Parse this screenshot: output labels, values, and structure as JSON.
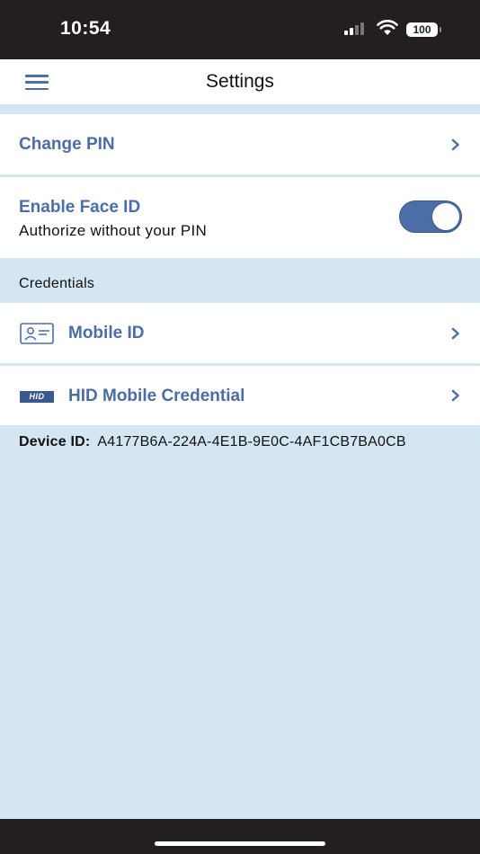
{
  "status_bar": {
    "time": "10:54",
    "battery": "100",
    "icons": [
      "signal-icon",
      "wifi-icon",
      "battery-icon"
    ]
  },
  "nav": {
    "title": "Settings",
    "menu_icon": "hamburger-menu-icon"
  },
  "settings": {
    "change_pin": {
      "label": "Change PIN"
    },
    "face_id": {
      "label": "Enable Face ID",
      "description": "Authorize without your PIN",
      "enabled": true
    }
  },
  "credentials": {
    "header": "Credentials",
    "items": [
      {
        "label": "Mobile ID",
        "icon": "id-card-icon"
      },
      {
        "label": "HID Mobile Credential",
        "icon": "hid-logo-icon",
        "badge": "HID"
      }
    ]
  },
  "device": {
    "label": "Device ID:",
    "value": "A4177B6A-224A-4E1B-9E0C-4AF1CB7BA0CB"
  },
  "colors": {
    "accent": "#4a6ea5",
    "background": "#d4e6f1",
    "status_bar": "#231f20"
  }
}
